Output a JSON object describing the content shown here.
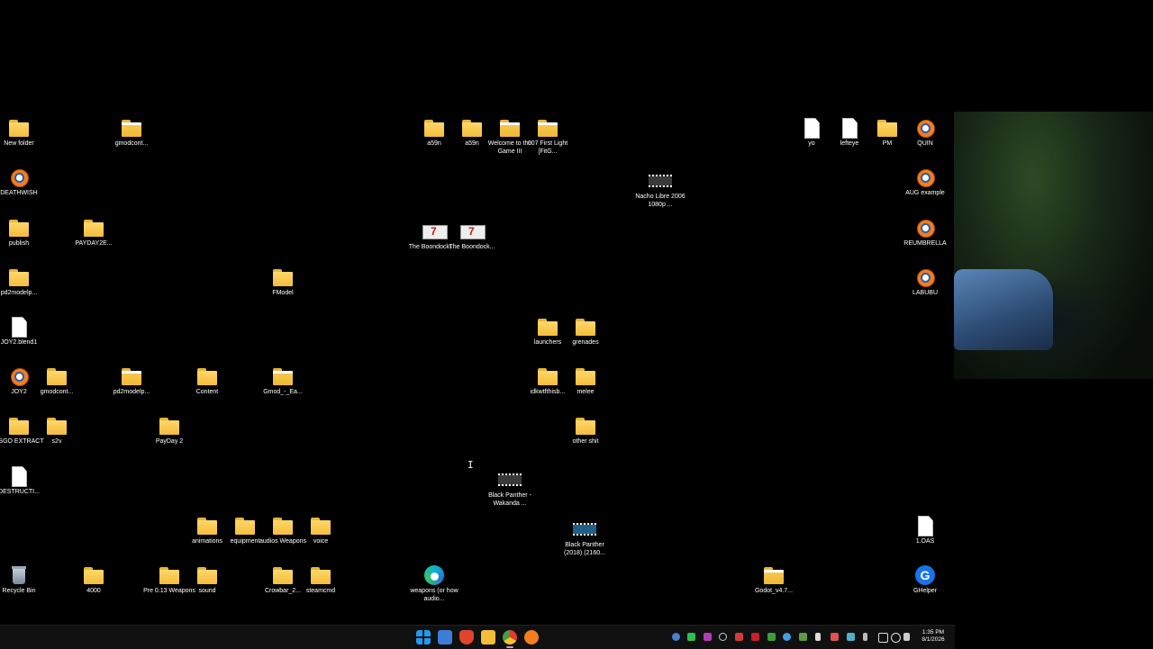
{
  "desktop": {
    "icons": [
      {
        "label": "New folder",
        "type": "folder"
      },
      {
        "label": "gmodcont...",
        "type": "folder"
      },
      {
        "label": "a59n",
        "type": "folder"
      },
      {
        "label": "a59n",
        "type": "folder"
      },
      {
        "label": "Welcome to the Game III",
        "type": "folder"
      },
      {
        "label": "007 First Light [FitG...",
        "type": "folder"
      },
      {
        "label": "yo",
        "type": "file"
      },
      {
        "label": "lefteye",
        "type": "file"
      },
      {
        "label": "PM",
        "type": "folder"
      },
      {
        "label": "QUIN",
        "type": "blender"
      },
      {
        "label": "DEATHWISH",
        "type": "blender"
      },
      {
        "label": "Nacho Libre 2006 1080p ...",
        "type": "video"
      },
      {
        "label": "AUG example",
        "type": "blender"
      },
      {
        "label": "publish",
        "type": "folder"
      },
      {
        "label": "PAYDAY2E...",
        "type": "folder"
      },
      {
        "label": "The Boondocks ...",
        "type": "video"
      },
      {
        "label": "The Boondock...",
        "type": "video"
      },
      {
        "label": "REUMBRELLA",
        "type": "blender"
      },
      {
        "label": "pd2modelp...",
        "type": "folder"
      },
      {
        "label": "FModel",
        "type": "folder"
      },
      {
        "label": "LABUBU",
        "type": "blender"
      },
      {
        "label": "JOY2.blend1",
        "type": "file"
      },
      {
        "label": "launchers",
        "type": "folder"
      },
      {
        "label": "grenades",
        "type": "folder"
      },
      {
        "label": "JOY2",
        "type": "blender"
      },
      {
        "label": "gmodcont...",
        "type": "folder"
      },
      {
        "label": "pd2modelp...",
        "type": "folder"
      },
      {
        "label": "Content",
        "type": "folder"
      },
      {
        "label": "Gmod_-_Ea...",
        "type": "folder"
      },
      {
        "label": "idkwtfthisb...",
        "type": "folder"
      },
      {
        "label": "melee",
        "type": "folder"
      },
      {
        "label": "CSGO EXTRACT",
        "type": "folder"
      },
      {
        "label": "s2v",
        "type": "folder"
      },
      {
        "label": "PayDay 2",
        "type": "folder"
      },
      {
        "label": "other shit",
        "type": "folder"
      },
      {
        "label": "DESTRUCTI...",
        "type": "file"
      },
      {
        "label": "Black Panther - Wakanda ...",
        "type": "video"
      },
      {
        "label": "animations",
        "type": "folder"
      },
      {
        "label": "equipment",
        "type": "folder"
      },
      {
        "label": "audios Weapons",
        "type": "folder"
      },
      {
        "label": "voice",
        "type": "folder"
      },
      {
        "label": "Black Panther (2018) (2160...",
        "type": "video"
      },
      {
        "label": "1.OAS",
        "type": "file"
      },
      {
        "label": "Recycle Bin",
        "type": "recycle"
      },
      {
        "label": "4000",
        "type": "folder"
      },
      {
        "label": "Pre 0.13 Weapons",
        "type": "folder"
      },
      {
        "label": "sound",
        "type": "folder"
      },
      {
        "label": "Crowbar_2...",
        "type": "folder"
      },
      {
        "label": "steamcmd",
        "type": "folder"
      },
      {
        "label": "weapons (or how audio...",
        "type": "edge"
      },
      {
        "label": "Godot_v4.7...",
        "type": "folder"
      },
      {
        "label": "GHelper",
        "type": "ghelper"
      }
    ]
  },
  "taskbar": {
    "apps": [
      "start-icon",
      "gallery-icon",
      "brave-icon",
      "file-explorer-icon",
      "chrome-icon",
      "blender-icon"
    ],
    "clock": {
      "time": "1:35 PM",
      "date": "8/1/2026"
    }
  }
}
